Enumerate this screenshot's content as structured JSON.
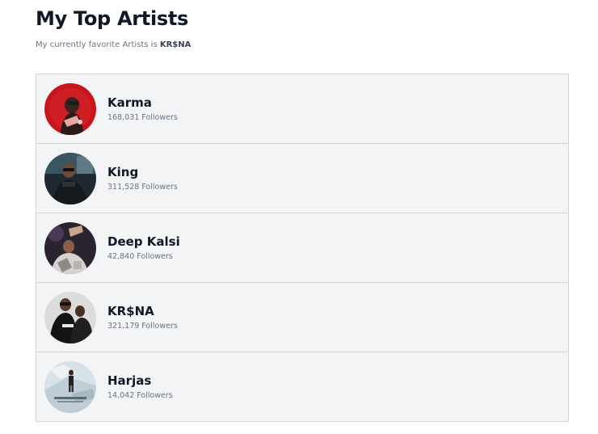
{
  "header": {
    "title": "My Top Artists",
    "subtitle_prefix": "My currently favorite Artists is ",
    "favorite_artist": "KR$NA"
  },
  "artists": [
    {
      "name": "Karma",
      "followers": "168,031 Followers",
      "avatar_icon": "artist-photo-karma"
    },
    {
      "name": "King",
      "followers": "311,528 Followers",
      "avatar_icon": "artist-photo-king"
    },
    {
      "name": "Deep Kalsi",
      "followers": "42,840 Followers",
      "avatar_icon": "artist-photo-deep-kalsi"
    },
    {
      "name": "KR$NA",
      "followers": "321,179 Followers",
      "avatar_icon": "artist-photo-krsna"
    },
    {
      "name": "Harjas",
      "followers": "14,042 Followers",
      "avatar_icon": "artist-photo-harjas"
    }
  ],
  "colors": {
    "title": "#111827",
    "muted_text": "#6b7280",
    "list_background": "#f3f4f6",
    "list_border": "#d1d5db"
  }
}
